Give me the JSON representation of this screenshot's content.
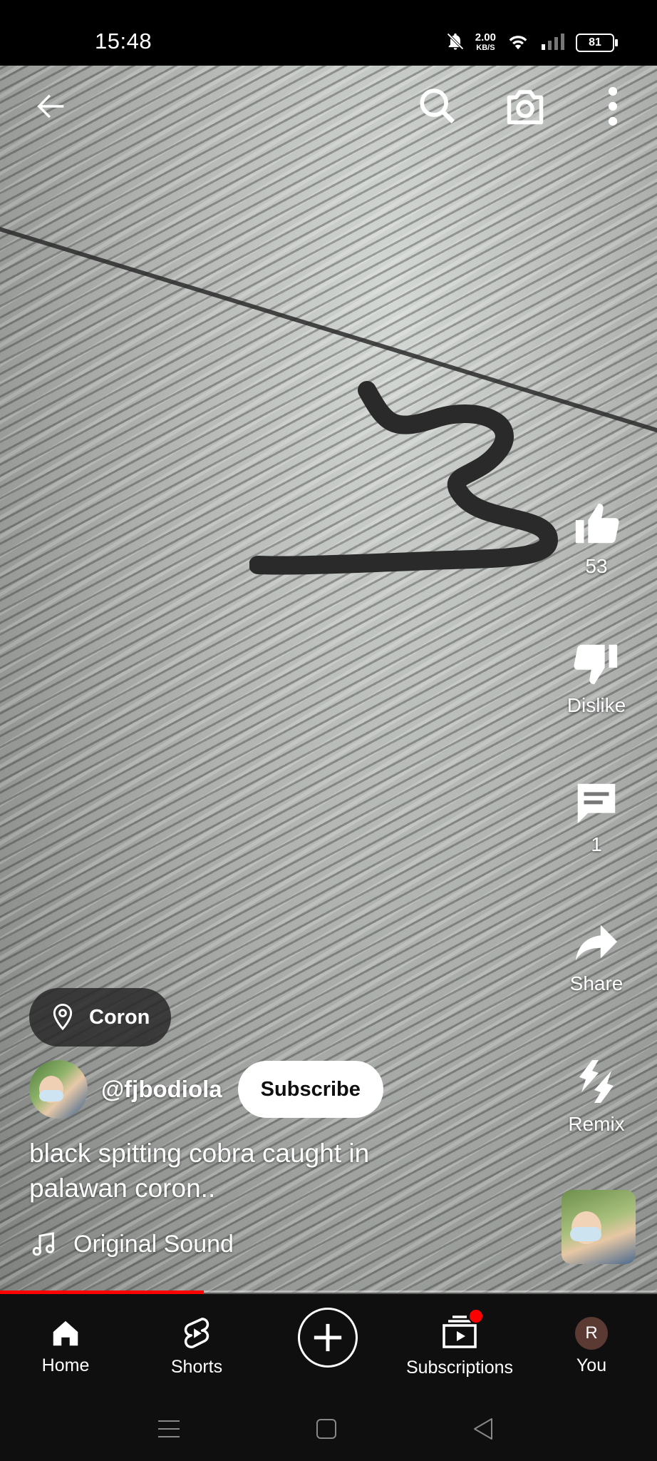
{
  "status_bar": {
    "time": "15:48",
    "net_speed_value": "2.00",
    "net_speed_unit": "KB/S",
    "battery": "81"
  },
  "top_bar": {
    "back_icon": "arrow-left-icon",
    "search_icon": "search-icon",
    "camera_icon": "camera-icon",
    "more_icon": "more-vert-icon"
  },
  "actions": {
    "like_count": "53",
    "dislike_label": "Dislike",
    "comment_count": "1",
    "share_label": "Share",
    "remix_label": "Remix"
  },
  "video": {
    "location": "Coron",
    "channel_handle": "@fjbodiola",
    "subscribe_label": "Subscribe",
    "title": "black  spitting cobra caught in palawan coron..",
    "sound_label": "Original Sound",
    "progress_fraction": 0.31
  },
  "bottom_nav": {
    "items": [
      {
        "label": "Home",
        "icon": "home-icon"
      },
      {
        "label": "Shorts",
        "icon": "shorts-icon"
      },
      {
        "label": "",
        "icon": "create-plus-icon"
      },
      {
        "label": "Subscriptions",
        "icon": "subscriptions-icon"
      },
      {
        "label": "You",
        "icon": "avatar"
      }
    ],
    "you_initial": "R"
  },
  "colors": {
    "accent": "#ff0000",
    "nav_bg": "#0f0f0f",
    "subscribe_bg": "#ffffff"
  }
}
